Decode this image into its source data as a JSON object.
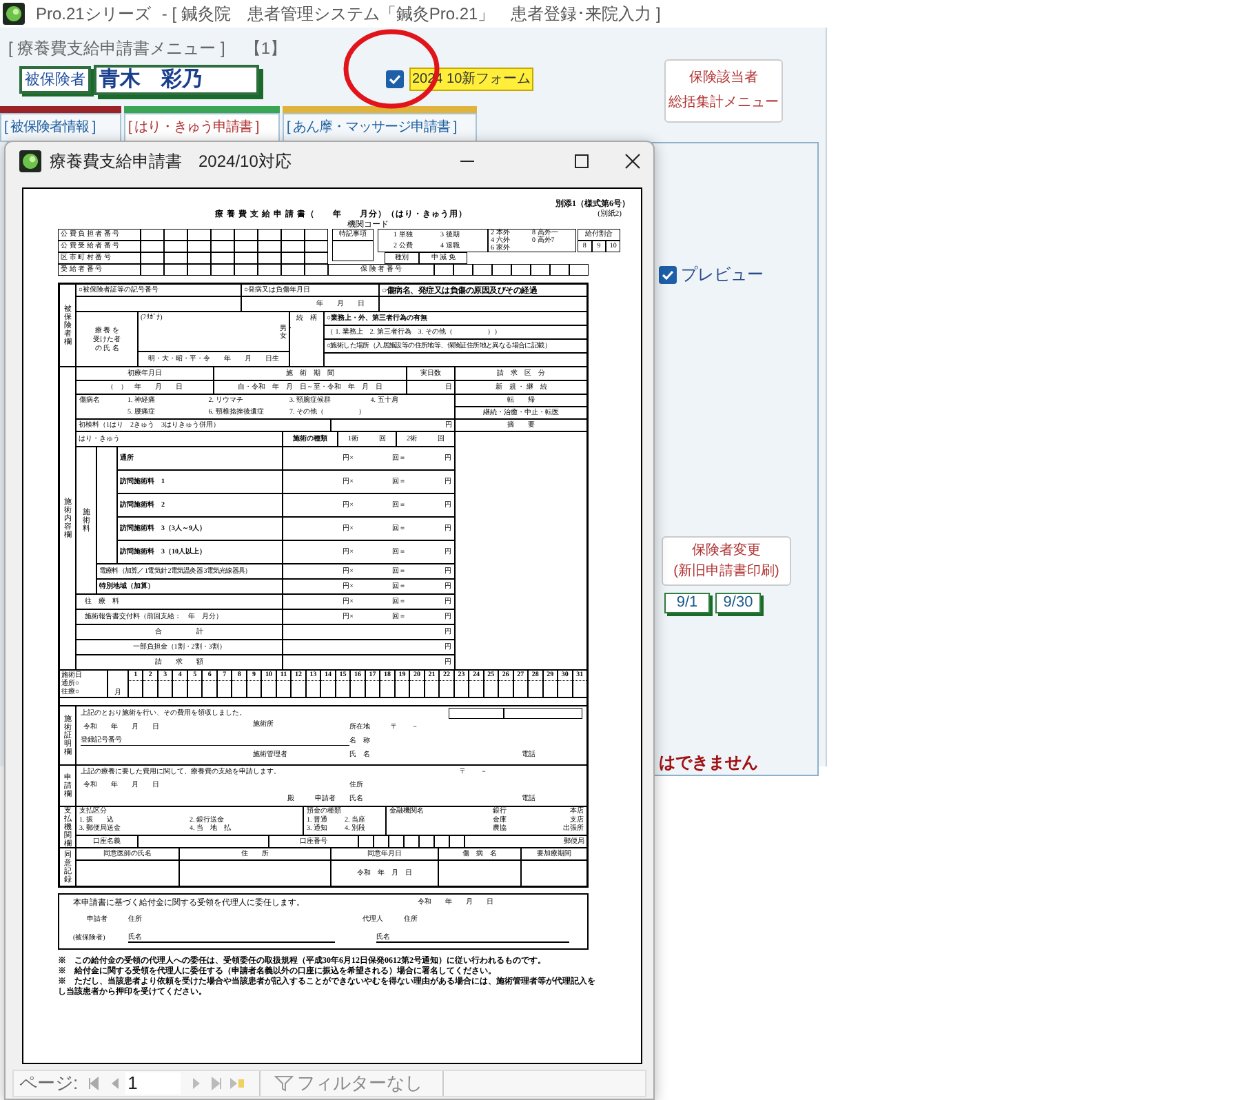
{
  "title_bar": {
    "app": "Pro.21シリーズ",
    "caption": "- [ 鍼灸院　患者管理システム「鍼灸Pro.21」　患者登録･来院入力 ]"
  },
  "menu_title": "[ 療養費支給申請書メニュー ]",
  "page_marker": "【1】",
  "insured_label": "被保険者",
  "insured_name": "青木　彩乃",
  "new_form": {
    "checked": true,
    "label": "2024 10新フォーム"
  },
  "annotation": {
    "kind": "ellipse"
  },
  "summary_button": [
    "保険該当者",
    "総括集計メニュー"
  ],
  "tabs": [
    {
      "label": "[ 被保険者情報 ]",
      "selected": false,
      "color": "#9b2226"
    },
    {
      "label": "[ はり・きゅう申請書 ]",
      "selected": true,
      "color": "#3aa655"
    },
    {
      "label": "[ あん摩・マッサージ申請書 ]",
      "selected": false,
      "color": "#e0b43c"
    }
  ],
  "preview": {
    "checked": true,
    "label": "プレビュー"
  },
  "change_button": [
    "保険者変更",
    "(新旧申請書印刷)"
  ],
  "dates": [
    "9/1",
    "9/30"
  ],
  "warning": "はできません",
  "dialog": {
    "title": "療養費支給申請書　2024/10対応"
  },
  "document": {
    "form_no": "別添1（様式第6号）",
    "title": "療 養 費 支 給 申 請 書（　　年　　月分）（はり・きゅう用）",
    "attachment": "(別紙2)",
    "org_code": "機関コード",
    "code_rows": [
      "公 費 負 担 者 番 号",
      "公 費 受 給 者 番 号",
      "区 市 町 村 番 号"
    ],
    "recipient_no": "受 給 者 番 号",
    "special": "特記事項",
    "kind_codes": [
      "1 単独",
      "3 後期",
      "2 公費",
      "4 退職"
    ],
    "type_codes": [
      "2 本外",
      "8 高外一",
      "4 六外",
      "0 高外7",
      "6 家外"
    ],
    "category": [
      "種別",
      "中 減 免"
    ],
    "ratio_label": "給付割合",
    "ratios": [
      "8",
      "9",
      "10"
    ],
    "insurer_no": "保 険 者 番 号",
    "patient": {
      "side": "被保険者欄",
      "id_label": "○被保険者証等の記号番号",
      "onset_label": "○発病又は負傷年月日",
      "onset_date": "年　　月　　日",
      "cause_label": "○傷病名、発症又は負傷の原因及びその経過",
      "name_label": [
        "療 養 を",
        "受けた者",
        "の 氏 名"
      ],
      "furigana": "(ﾌﾘｶﾞﾅ)",
      "sex": "男・女",
      "birth": "明・大・昭・平・令　　年　　月　　日生",
      "relation": "続　柄",
      "work_label": "○業務上・外、第三者行為の有無",
      "work_options": "（ 1. 業務上　2. 第三者行為　3. その他（　　　　　））",
      "place_label": "○施術した場所（入居施設等の住所地等、保険証住所地と異なる場合に記載）"
    },
    "treatment": {
      "side": "施術内容欄",
      "head": [
        "初療年月日",
        "施　術　期　間",
        "実日数",
        "請　求　区　分"
      ],
      "values": [
        "（　）　年　　月　　日",
        "自・令和　年　月　日～至・令和　年　月　日",
        "日",
        "新　規 ・ 継　続"
      ],
      "disease_label": "傷病名",
      "diseases": [
        "1. 神経痛",
        "2. リウマチ",
        "3. 頸腕症候群",
        "4. 五十肩",
        "5. 腰痛症",
        "6. 頸椎捻挫後遺症",
        "7. その他（　　　　　）"
      ],
      "outcome_label": "転　　帰",
      "outcomes": "継続・治癒・中止・転医",
      "first_fee": "初検料（1はり　2きゅう　3はりきゅう併用）",
      "first_fee_yen": "円",
      "remarks": "摘　　要",
      "fee_group": "はり・きゅう",
      "fee_head": [
        "施術の種類",
        "1術　　　回",
        "2術　　　回"
      ],
      "fee_side": "施術料",
      "fees": [
        {
          "kind": "main",
          "label": "通所",
          "unit": "円×",
          "count": "回＝",
          "yen": "円"
        },
        {
          "kind": "main",
          "label": "訪問施術料　1",
          "unit": "円×",
          "count": "回＝",
          "yen": "円"
        },
        {
          "kind": "main",
          "label": "訪問施術料　2",
          "unit": "円×",
          "count": "回＝",
          "yen": "円"
        },
        {
          "kind": "main",
          "label": "訪問施術料　3（3人～9人）",
          "unit": "円×",
          "count": "回＝",
          "yen": "円"
        },
        {
          "kind": "main",
          "label": "訪問施術料　3（10人以上）",
          "unit": "円×",
          "count": "回＝",
          "yen": "円"
        },
        {
          "kind": "addon",
          "label": "電療料（加算／ 1電気針 2電気温灸器 3電気光線器具）",
          "unit": "円×",
          "count": "回＝",
          "yen": "円"
        },
        {
          "kind": "addon",
          "label": "特別地域（加算）",
          "unit": "円×",
          "count": "回＝",
          "yen": "円"
        },
        {
          "kind": "other",
          "label": "往　療　料",
          "unit": "円×",
          "count": "回＝",
          "yen": "円"
        },
        {
          "kind": "other",
          "label": "施術報告書交付料（前回支給：　年　月分）",
          "unit": "円×",
          "count": "回＝",
          "yen": "円"
        },
        {
          "kind": "total",
          "label": "合　　　　　計",
          "yen": "円"
        },
        {
          "kind": "total",
          "label": "一部負担金（1割・2割・3割）",
          "yen": "円"
        },
        {
          "kind": "total",
          "label": "請　　求　　額",
          "yen": "円"
        }
      ]
    },
    "calendar": {
      "label": "施術日",
      "marks": [
        "通所○",
        "往療○"
      ],
      "month": "月",
      "days": [
        "1",
        "2",
        "3",
        "4",
        "5",
        "6",
        "7",
        "8",
        "9",
        "10",
        "11",
        "12",
        "13",
        "14",
        "15",
        "16",
        "17",
        "18",
        "19",
        "20",
        "21",
        "22",
        "23",
        "24",
        "25",
        "26",
        "27",
        "28",
        "29",
        "30",
        "31"
      ]
    },
    "certificate": {
      "side": "施術証明欄",
      "statement": "上記のとおり施術を行い、その費用を領収しました。",
      "date": "令和　　年　　月　　日",
      "reg_no": "登録記号番号",
      "clinic": "施術所",
      "postal": "〒　　－",
      "address": "所在地",
      "name": "名　称",
      "manager": "施術管理者",
      "person": "氏　名",
      "phone": "電話"
    },
    "application": {
      "side": "申請欄",
      "statement": "上記の療養に要した費用に関して、療養費の支給を申請します。",
      "postal": "〒　　－",
      "date": "令和　　年　　月　　日",
      "addressee": "殿",
      "applicant": "申請者",
      "address": "住所",
      "person": "氏名",
      "phone": "電話"
    },
    "payment": {
      "side": "支払機関欄",
      "method_label": "支払区分",
      "methods": [
        "1. 振　　込",
        "2. 銀行送金",
        "3. 郵便局送金",
        "4. 当　地　払"
      ],
      "deposit_label": "預金の種類",
      "deposits": [
        "1. 普通",
        "2. 当座",
        "3. 通知",
        "4. 別段"
      ],
      "bank_label": "金融機関名",
      "bank_types": [
        "銀行",
        "金庫",
        "農協"
      ],
      "branch_types": [
        "本店",
        "支店",
        "出張所"
      ],
      "holder": "口座名義",
      "account_no": "口座番号",
      "post": "郵便局"
    },
    "consent": {
      "side": "同意記録",
      "head": [
        "同意医師の氏名",
        "住　　所",
        "同意年月日",
        "傷　病　名",
        "要加療期間"
      ],
      "date": "令和　年　月　日"
    },
    "delegation": {
      "statement": "本申請書に基づく給付金に関する受領を代理人に委任します。",
      "date": "令和　　年　　月　　日",
      "applicant": "申請者",
      "address1": "住所",
      "insured": "(被保険者)",
      "name1": "氏名",
      "agent": "代理人",
      "address2": "住所",
      "name2": "氏名"
    },
    "notes": [
      "※　この給付金の受領の代理人への委任は、受領委任の取扱規程（平成30年6月12日保発0612第2号通知）に従い行われるものです。",
      "※　給付金に関する受領を代理人に委任する（申請者名義以外の口座に振込を希望される）場合に署名してください。",
      "※　ただし、当該患者より依頼を受けた場合や当該患者が記入することができないやむを得ない理由がある場合には、施術管理者等が代理記入をし当該患者から押印を受けてください。"
    ]
  },
  "pager": {
    "label": "ページ:",
    "page": "1",
    "filter": "フィルターなし"
  }
}
